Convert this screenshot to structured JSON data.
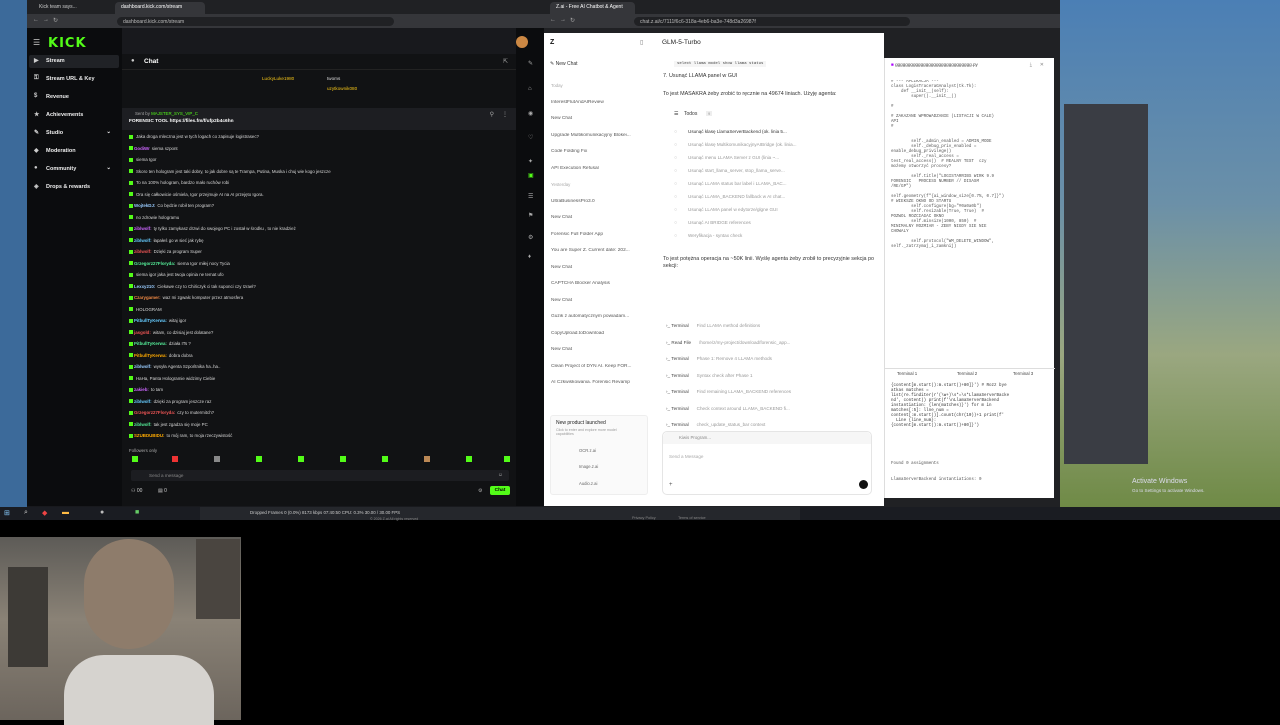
{
  "left_browser": {
    "tabs": [
      "Kick team says...",
      "dashboard.kick.com/stream"
    ],
    "url": "dashboard.kick.com/stream"
  },
  "kick": {
    "logo": "KICK",
    "nav": [
      "Stream",
      "Stream URL & Key",
      "Revenue",
      "Achievements",
      "Studio",
      "Moderation",
      "Community",
      "Drops & rewards"
    ],
    "chat_title": "Chat",
    "top_users": [
      "LuckyLuke1980",
      "twoms",
      "uzytkownik080"
    ],
    "pinned_by": "Sent by",
    "pinned_user": "MAJSTER_SYS_VIP_C",
    "pinned_text": "FORENSIC TOOL https://files.fm/f/ufp2b4c6hn",
    "messages": [
      {
        "u": "",
        "t": "Jaka droga mleczna jest w tych logach co zapisuje logistrasec?"
      },
      {
        "u": "GodiWr",
        "t": "siema szpont"
      },
      {
        "u": "",
        "t": "siema Igor"
      },
      {
        "u": "",
        "t": "Skoro ten hologram jest taki dobry, to jak dobre są te Trampa, Putina, Muska i chuj wie kogo jeszcze"
      },
      {
        "u": "",
        "t": "To na 100% hologram, bardzo mało ruchów robi"
      },
      {
        "u": "",
        "t": "Ora się całkowicie ośmiela, Igor przejmuje AI na AI przejęto Igora."
      },
      {
        "u": "WojtekDJ:",
        "t": "Co będzie robił ten program?"
      },
      {
        "u": "",
        "t": "no zdrowie hologramu"
      },
      {
        "u": "ziblwolf:",
        "t": "ty tylko zamykasz drzwi do swojego PC i został w środku , to nie kradzież"
      },
      {
        "u": "ziblwolf:",
        "t": "łapałeś go w sieć jak rybę"
      },
      {
        "u": "ziblwolf:",
        "t": "Dzięki za program Super"
      },
      {
        "u": "Grzegorz27Floryda:",
        "t": "siema Igor miłej nocy Tycia"
      },
      {
        "u": "",
        "t": "siema igor jaka jest twoja opinia ne temat ufo"
      },
      {
        "u": "Lexxy210:",
        "t": "Ciekawe czy to Chińczyk ci tak suponci czy Izrael?"
      },
      {
        "u": "Czarygamer:",
        "t": "waz mi zgwałc komputer przez atmosfera"
      },
      {
        "u": "",
        "t": "HOLOGRAM"
      },
      {
        "u": "PitbullTyKerwa:",
        "t": "witaj igor"
      },
      {
        "u": "jasgold:",
        "t": "witam, co dzisiaj jest dolatane?"
      },
      {
        "u": "PitbullTyKerwa:",
        "t": "działa ITs ?"
      },
      {
        "u": "PitbullTyKerwa:",
        "t": "dobra dobra"
      },
      {
        "u": "ziblwolf:",
        "t": "wysyła Agenta Szpońtnika ha..ha.."
      },
      {
        "u": "",
        "t": "HaHa, Panta Hologramie widzimy Ciebie"
      },
      {
        "u": "zakieb:",
        "t": "to tam"
      },
      {
        "u": "ziblwolf:",
        "t": "dzięki za program jeszcze raz"
      },
      {
        "u": "Grzegorz27Floryda:",
        "t": "czy to mutermitch?"
      },
      {
        "u": "ziblwolf:",
        "t": "tak jest zgadza się moje PC"
      },
      {
        "u": "SZUBDUBIDU:",
        "t": "to mój ram, to moja rzeczywistość"
      }
    ],
    "followers_only": "Followers only",
    "send_placeholder": "Send a message",
    "viewers": "00",
    "chat_button": "Chat"
  },
  "right_browser": {
    "tabs": [
      "Z.ai - Free AI Chatbot & Agent",
      "chat.z.ai"
    ],
    "url": "chat.z.ai/c/7111f6c6-318a-4eb6-ba3e-748d3a26987f"
  },
  "zai": {
    "new_chat": "New Chat",
    "model": "GLM-5-Turbo",
    "sidebar": [
      "Today",
      "InterestFlutAndAIReview",
      "New Chat",
      "Upgrade Multikomunikacyjny Blokei...",
      "Code Folding Fix",
      "API Execution Refusal",
      "Yesterday",
      "UltraBusinessPro3.0",
      "New Chat",
      "Forensic Full Folder App",
      "You are Super Z. Current date: 202...",
      "New Chat",
      "CAPTCHA Blocker Analysis",
      "New Chat",
      "Guzik z automatycznym powiadam...",
      "CopyUpload.toDownload",
      "New Chat",
      "Clean Project of DYN AI. Keep FOR...",
      "AI Czkwiskowania. Forensic Revamp"
    ],
    "promo_title": "New product launched",
    "promo_text": "Click to enter and explore more model capabilities",
    "promo_links": [
      "OCR.z.ai",
      "Image.z.ai",
      "Audio.z.ai"
    ],
    "top_code": "select llama model   show llama status",
    "step": "7. Usunąć LLAMA panel w GUI",
    "intro": "To jest MASAKRA żeby zrobić to ręcznie na 49674 liniach. Użyję agenta:",
    "todos_title": "Todos",
    "todos_count": "9",
    "todos": [
      "Usunąć klasę LlamaServerBackend (ok. linia 5...",
      "Usunąć klasę MultikomunikacyjnyAIBridge (ok. linia...",
      "Usunąć menu LLAMA Server z GUI (linia ~...",
      "Usunąć start_llama_server, stop_llama_serve...",
      "Usunąć LLAMA status bar label i LLAMA_BAC...",
      "Usunąć LLAMA_BACKEND fallback w AI chat...",
      "Usunąć LLAMA panel w edytorze/glgne GUI",
      "Usunąć AI BRIDGE references",
      "Weryfikacja - syntax check"
    ],
    "para2": "To jest potężna operacja na ~50K linii. Wyślę agenta żeby zrobił to precyzyjnie sekcja po sekcji:",
    "terms": [
      {
        "l": "Terminal",
        "d": "Find LLAMA method definitions"
      },
      {
        "l": "Read File",
        "d": "/home/z/my-project/download/forensic_app..."
      },
      {
        "l": "Terminal",
        "d": "Phase 1: Remove 4 LLAMA methods"
      },
      {
        "l": "Terminal",
        "d": "Syntax check after Phase 1"
      },
      {
        "l": "Terminal",
        "d": "Find remaining LLAMA_BACKEND references"
      },
      {
        "l": "Terminal",
        "d": "Check context around LLAMA_BACKEND fi..."
      },
      {
        "l": "Terminal",
        "d": "check_update_status_bar context"
      }
    ],
    "input_placeholder": "Send a Message",
    "thinking": "Kiwis Program...",
    "file_tab": "gggggggggggggggggggggggggggggg.py",
    "code": "# --- APLIKACJA ---\nclass LogisTraceraGAnalyst(tk.Tk):\n    def __init__(self):\n        super().__init__()\n\n#\n\n# ZAKAZANE WPROWADZANIE (LISTACJI W CALE)\nAPI\n#\n\n\n        self._admin_enabled = ADMIN_MODE\n        self._debug_priv_enabled =\nenable_debug_privilege()\n        self._real_access =\ntest_real_access()  # REALNY TEST  czy\nmożemy otworzyć procesy?\n\n        self.title(\"LOGISTARRIBS WIRK 9.9\nFORENSIC   PROCESS NUMBER // DISASM\n/RE/GP\")\n\nself.geometry(f\"{ai_window_size[0.7%, 0.7]}\")\n# WIEKSZE OKNO OD STARTU\n        self.configure(bg=\"#0a0a0b\")\n        self.resizable(True, True)  #\nPOZWOL ROZCIAGAC OKNO\n        self.minsize(1000, 850)  #\nMINIMALNY ROZMIAR - ZEBY NIGDY SIE NIE\nCHOWALY\n\n        self.protocol(\"WM_DELETE_WINDOW\",\nself._zatrzymaj_i_zamknij)",
    "terminal_tabs": [
      "Terminal 1",
      "Terminal 2",
      "Terminal 3"
    ],
    "term_out": "{content[m.start():m.start()+80]}') # Rozz bye\natkas matches = \nlist(re.finditer(r'(\\w+)\\s*=\\s*LlamaServerBacke\nnd', content)) print(f'\\nLlamaServerBackend\ninstantiation: {len(matches)}') for m in\nmatches[:5]: llne_num =\ncontent[:m.start()].count(chr(10))+1 print(f'\n  Line {line_num}:\n{content[m.start():m.start()+80]}')",
    "found": "Found 0 assignments",
    "found2": "LlamaServerBackend instantiations: 0"
  },
  "bottom": {
    "obs_status": "Dropped Frames 0 (0.0%)   8173 kbps   07:40:50   CPU: 0.3%   30.00 / 30.00 FPS",
    "windows_active": "Activate Windows",
    "windows_sub": "Go to Settings to activate Windows.",
    "footer_left": "© 2026 Z.ai All rights reserved",
    "footer_links": [
      "Privacy Policy",
      "Terms of service"
    ]
  },
  "colors": {
    "kick_green": "#53fc18",
    "zai_bg": "#ffffff",
    "kick_bg": "#111214"
  }
}
